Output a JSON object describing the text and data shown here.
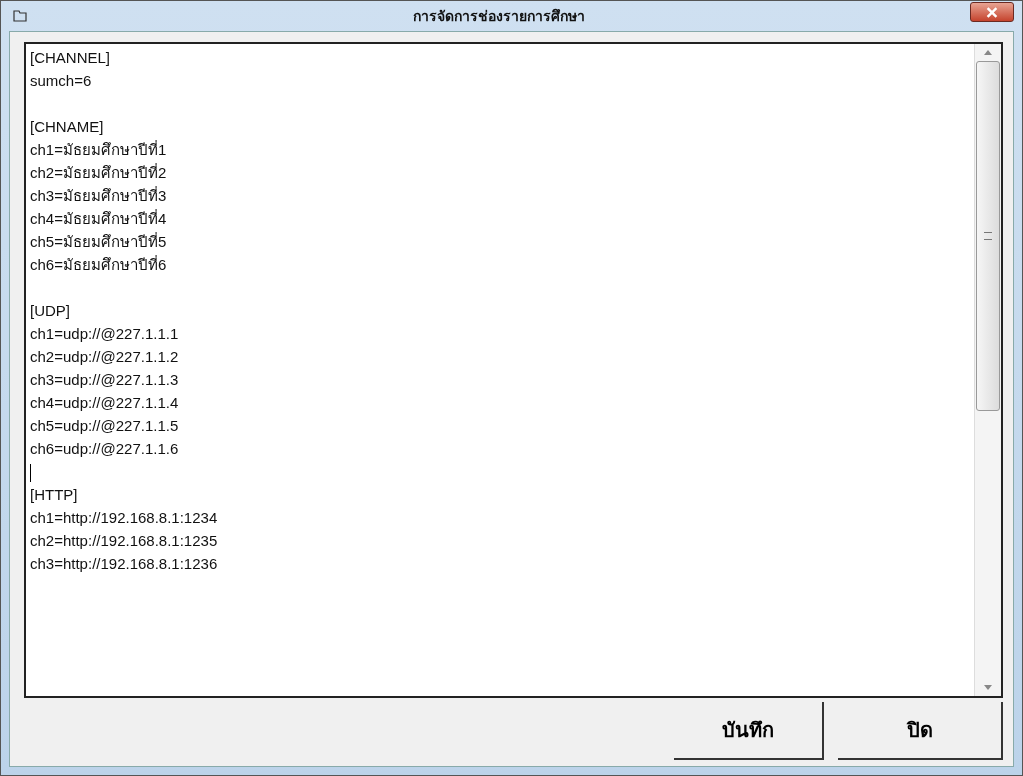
{
  "window": {
    "title": "การจัดการช่องรายการศึกษา"
  },
  "editor": {
    "sections": [
      {
        "lines": [
          "[CHANNEL]",
          "sumch=6"
        ],
        "caret_after": false
      },
      {
        "lines": [
          "[CHNAME]",
          "ch1=มัธยมศึกษาปีที่1",
          "ch2=มัธยมศึกษาปีที่2",
          "ch3=มัธยมศึกษาปีที่3",
          "ch4=มัธยมศึกษาปีที่4",
          "ch5=มัธยมศึกษาปีที่5",
          "ch6=มัธยมศึกษาปีที่6"
        ],
        "caret_after": false
      },
      {
        "lines": [
          "[UDP]",
          "ch1=udp://@227.1.1.1",
          "ch2=udp://@227.1.1.2",
          "ch3=udp://@227.1.1.3",
          "ch4=udp://@227.1.1.4",
          "ch5=udp://@227.1.1.5",
          "ch6=udp://@227.1.1.6"
        ],
        "caret_after": true
      },
      {
        "lines": [
          "[HTTP]",
          "ch1=http://192.168.8.1:1234",
          "ch2=http://192.168.8.1:1235",
          "ch3=http://192.168.8.1:1236"
        ],
        "caret_after": false
      }
    ]
  },
  "buttons": [
    "บันทึก",
    "ปิด"
  ]
}
